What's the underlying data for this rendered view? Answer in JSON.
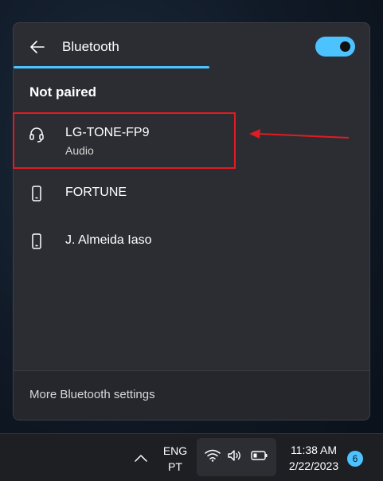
{
  "panel": {
    "title": "Bluetooth",
    "toggle_on": true,
    "accent_color": "#4cc2ff",
    "scan_progress": 0.55,
    "section_title": "Not paired",
    "devices": [
      {
        "name": "LG-TONE-FP9",
        "type": "Audio",
        "icon": "headset-icon"
      },
      {
        "name": "FORTUNE",
        "type": "",
        "icon": "phone-icon"
      },
      {
        "name": "J. Almeida Iaso",
        "type": "",
        "icon": "phone-icon"
      }
    ],
    "footer_link": "More Bluetooth settings"
  },
  "annotation": {
    "color": "#e11b22"
  },
  "taskbar": {
    "lang_line1": "ENG",
    "lang_line2": "PT",
    "time": "11:38 AM",
    "date": "2/22/2023",
    "notification_count": "6",
    "tray_icons": [
      "wifi-icon",
      "volume-icon",
      "battery-icon"
    ]
  }
}
